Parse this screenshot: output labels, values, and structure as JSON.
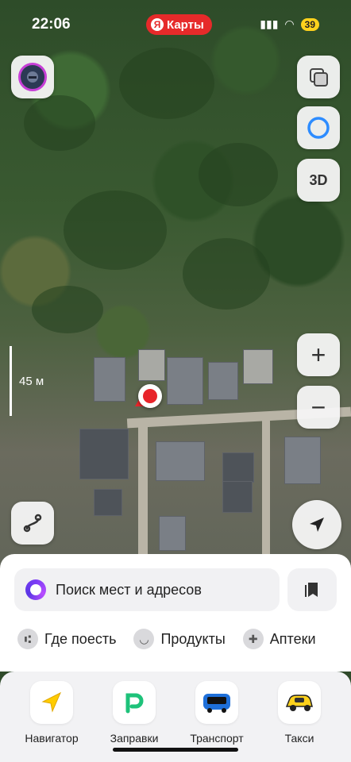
{
  "status_bar": {
    "time": "22:06",
    "app_badge": "Карты",
    "app_badge_logo": "Я",
    "battery": "39"
  },
  "map": {
    "scale_label": "45 м",
    "btn_3d": "3D",
    "zoom_in": "+",
    "zoom_out": "−"
  },
  "search": {
    "placeholder": "Поиск мест и адресов"
  },
  "chips": [
    {
      "label": "Где поесть",
      "icon": "fork-knife-icon"
    },
    {
      "label": "Продукты",
      "icon": "basket-icon"
    },
    {
      "label": "Аптеки",
      "icon": "plus-icon"
    }
  ],
  "dock": [
    {
      "label": "Навигатор",
      "icon": "navigator-arrow-icon"
    },
    {
      "label": "Заправки",
      "icon": "fuel-p-icon"
    },
    {
      "label": "Транспорт",
      "icon": "bus-icon"
    },
    {
      "label": "Такси",
      "icon": "taxi-car-icon"
    }
  ],
  "colors": {
    "accent_red": "#e8242a",
    "alice_purple": "#7b3cf5",
    "taxi_yellow": "#ffd21c"
  }
}
